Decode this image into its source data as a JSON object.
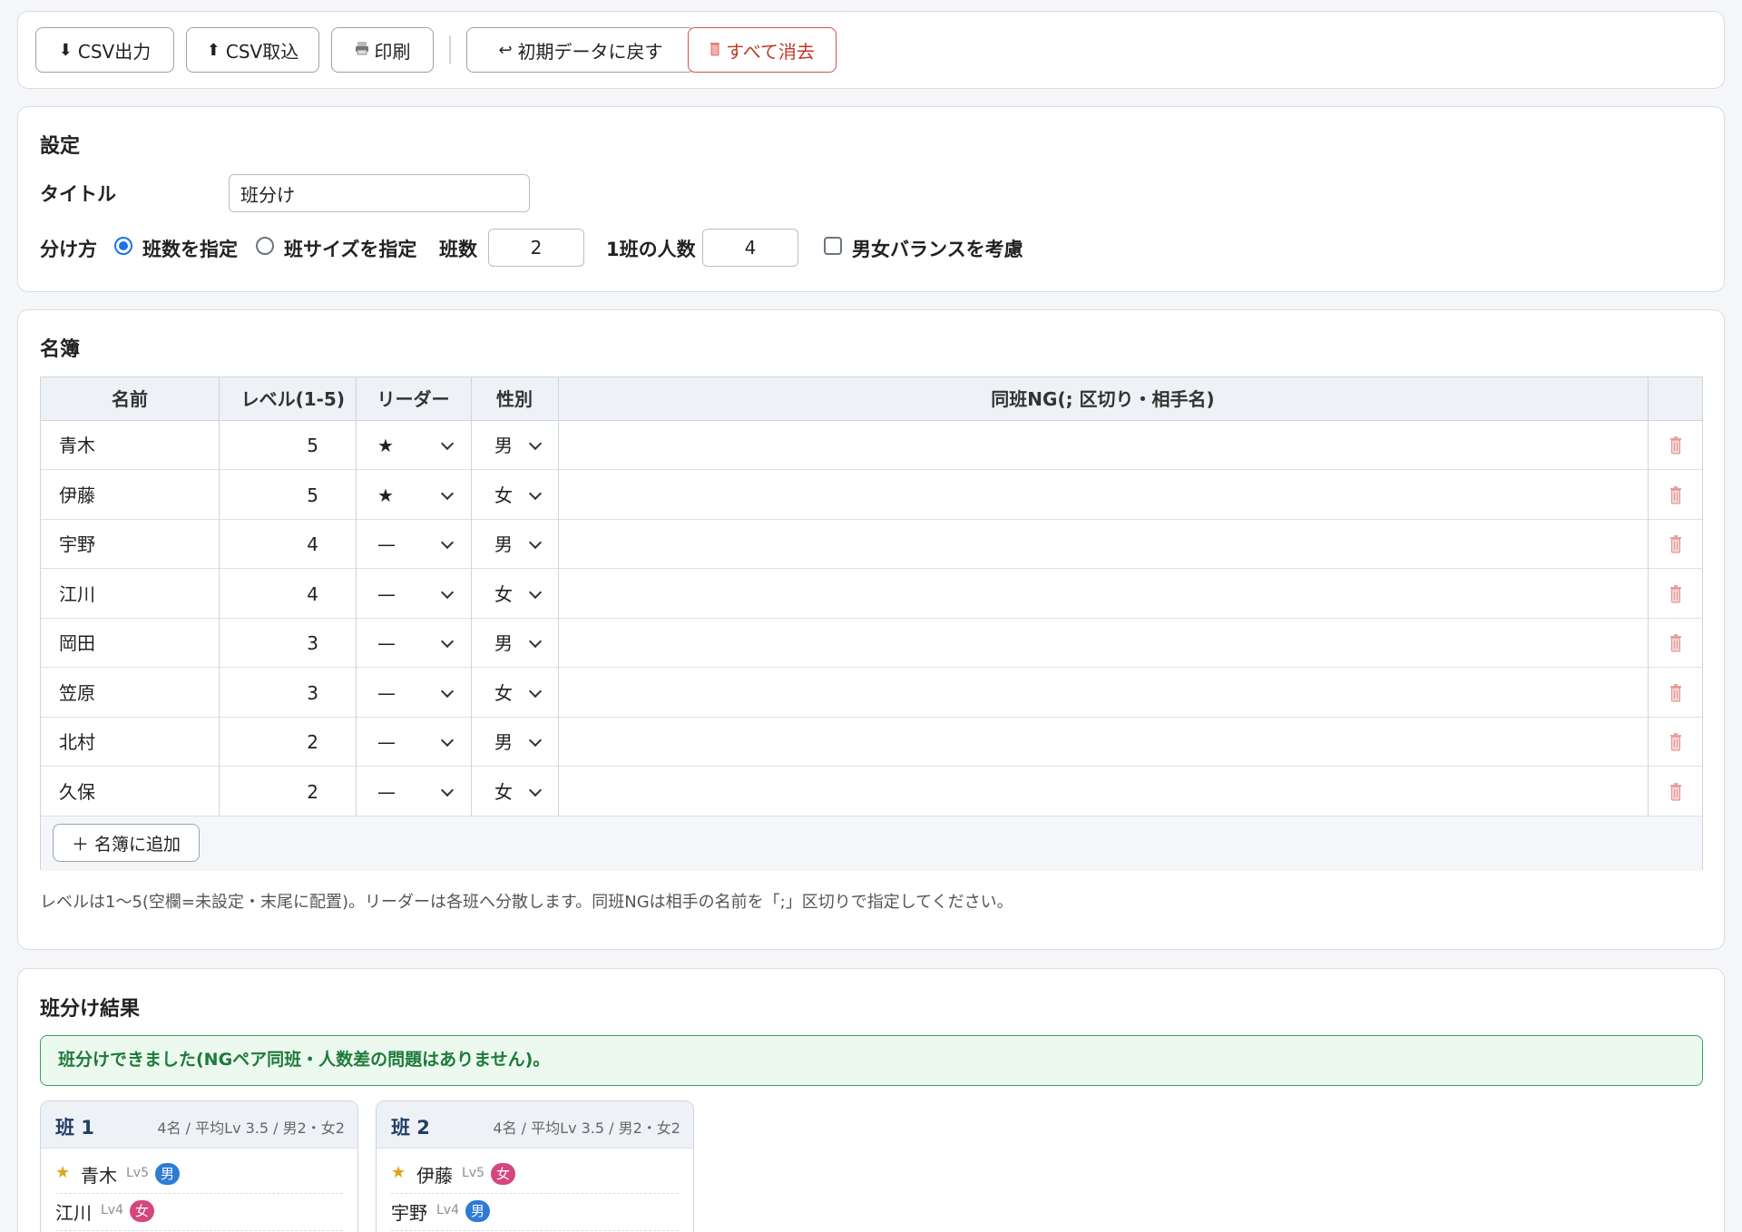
{
  "toolbar": {
    "csv_export": "CSV出力",
    "csv_import": "CSV取込",
    "print": "印刷",
    "reset": "初期データに戻す",
    "clear_all": "すべて消去"
  },
  "settings": {
    "heading": "設定",
    "title_label": "タイトル",
    "title_value": "班分け",
    "method_label": "分け方",
    "method_by_count": "班数を指定",
    "method_by_size": "班サイズを指定",
    "group_count_label": "班数",
    "group_count_value": "2",
    "group_size_label": "1班の人数",
    "group_size_value": "4",
    "gender_balance_label": "男女バランスを考慮"
  },
  "roster": {
    "heading": "名簿",
    "columns": [
      "名前",
      "レベル(1-5)",
      "リーダー",
      "性別",
      "同班NG(; 区切り・相手名)"
    ],
    "rows": [
      {
        "name": "青木",
        "level": "5",
        "leader": "★",
        "gender": "男",
        "ng": ""
      },
      {
        "name": "伊藤",
        "level": "5",
        "leader": "★",
        "gender": "女",
        "ng": ""
      },
      {
        "name": "宇野",
        "level": "4",
        "leader": "—",
        "gender": "男",
        "ng": ""
      },
      {
        "name": "江川",
        "level": "4",
        "leader": "—",
        "gender": "女",
        "ng": ""
      },
      {
        "name": "岡田",
        "level": "3",
        "leader": "—",
        "gender": "男",
        "ng": ""
      },
      {
        "name": "笠原",
        "level": "3",
        "leader": "—",
        "gender": "女",
        "ng": ""
      },
      {
        "name": "北村",
        "level": "2",
        "leader": "—",
        "gender": "男",
        "ng": ""
      },
      {
        "name": "久保",
        "level": "2",
        "leader": "—",
        "gender": "女",
        "ng": ""
      }
    ],
    "add_button": "＋ 名簿に追加",
    "note": "レベルは1〜5(空欄=未設定・末尾に配置)。リーダーは各班へ分散します。同班NGは相手の名前を「;」区切りで指定してください。"
  },
  "results": {
    "heading": "班分け結果",
    "message": "班分けできました(NGペア同班・人数差の問題はありません)。",
    "groups": [
      {
        "title": "班 1",
        "stats": "4名 / 平均Lv 3.5 / 男2・女2",
        "members": [
          {
            "leader": true,
            "name": "青木",
            "lv": "Lv5",
            "gender": "男"
          },
          {
            "leader": false,
            "name": "江川",
            "lv": "Lv4",
            "gender": "女"
          }
        ]
      },
      {
        "title": "班 2",
        "stats": "4名 / 平均Lv 3.5 / 男2・女2",
        "members": [
          {
            "leader": true,
            "name": "伊藤",
            "lv": "Lv5",
            "gender": "女"
          },
          {
            "leader": false,
            "name": "宇野",
            "lv": "Lv4",
            "gender": "男"
          }
        ]
      }
    ]
  },
  "colors": {
    "accent": "#1a73e8",
    "danger": "#c0392b",
    "success": "#1e7a3a",
    "male_badge": "#2f7bd6",
    "female_badge": "#d6457e",
    "leader_star": "#e0a21a"
  }
}
